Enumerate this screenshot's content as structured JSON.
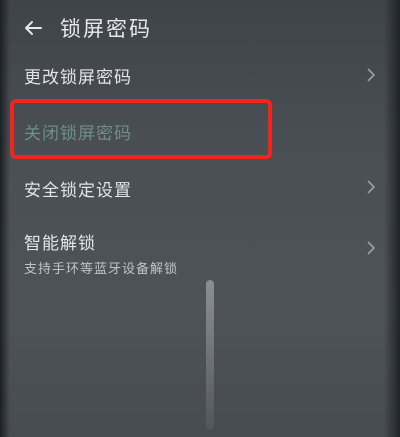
{
  "header": {
    "title": "锁屏密码"
  },
  "items": [
    {
      "label": "更改锁屏密码",
      "subtitle": ""
    },
    {
      "label": "关闭锁屏密码",
      "subtitle": ""
    },
    {
      "label": "安全锁定设置",
      "subtitle": ""
    },
    {
      "label": "智能解锁",
      "subtitle": "支持手环等蓝牙设备解锁"
    }
  ],
  "icons": {
    "back": "back-arrow-icon",
    "chevron": "chevron-right-icon"
  },
  "colors": {
    "highlight": "#f0261c",
    "background": "#4b4f54",
    "text": "#e2e5e8"
  }
}
